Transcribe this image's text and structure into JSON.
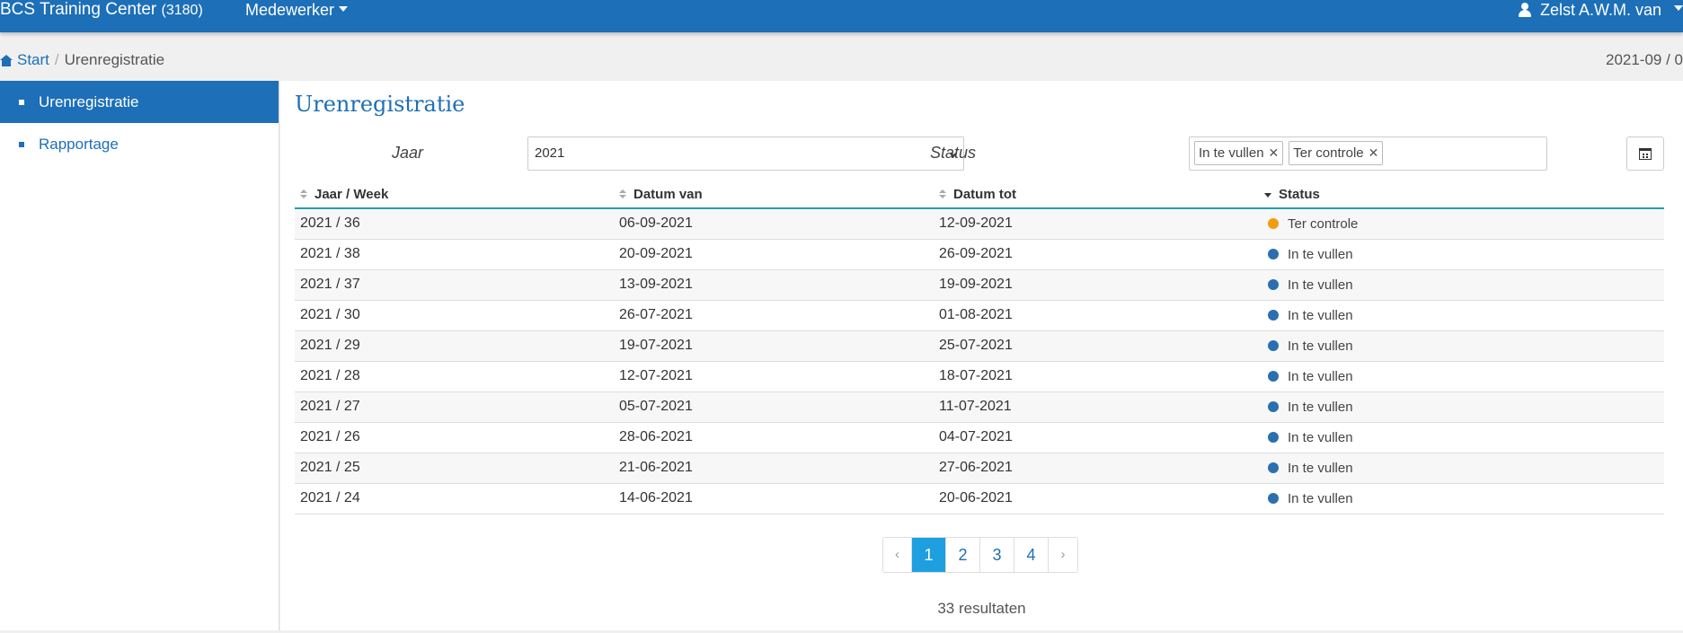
{
  "navbar": {
    "brand": "BCS Training Center",
    "brand_code": "(3180)",
    "menu_label": "Medewerker",
    "user_name": "Zelst A.W.M. van"
  },
  "breadcrumb": {
    "home": "Start",
    "current": "Urenregistratie",
    "date": "2021-09 / 0"
  },
  "sidebar": {
    "items": [
      {
        "label": "Urenregistratie"
      },
      {
        "label": "Rapportage"
      }
    ]
  },
  "main": {
    "title": "Urenregistratie",
    "filters": {
      "year_label": "Jaar",
      "year_value": "2021",
      "status_label": "Status",
      "status_tags": [
        "In te vullen",
        "Ter controle"
      ]
    },
    "table": {
      "headers": [
        "Jaar / Week",
        "Datum van",
        "Datum tot",
        "Status"
      ],
      "rows": [
        {
          "week": "2021 / 36",
          "from": "06-09-2021",
          "to": "12-09-2021",
          "status": "Ter controle",
          "color": "#f39c12"
        },
        {
          "week": "2021 / 38",
          "from": "20-09-2021",
          "to": "26-09-2021",
          "status": "In te vullen",
          "color": "#2c6fb0"
        },
        {
          "week": "2021 / 37",
          "from": "13-09-2021",
          "to": "19-09-2021",
          "status": "In te vullen",
          "color": "#2c6fb0"
        },
        {
          "week": "2021 / 30",
          "from": "26-07-2021",
          "to": "01-08-2021",
          "status": "In te vullen",
          "color": "#2c6fb0"
        },
        {
          "week": "2021 / 29",
          "from": "19-07-2021",
          "to": "25-07-2021",
          "status": "In te vullen",
          "color": "#2c6fb0"
        },
        {
          "week": "2021 / 28",
          "from": "12-07-2021",
          "to": "18-07-2021",
          "status": "In te vullen",
          "color": "#2c6fb0"
        },
        {
          "week": "2021 / 27",
          "from": "05-07-2021",
          "to": "11-07-2021",
          "status": "In te vullen",
          "color": "#2c6fb0"
        },
        {
          "week": "2021 / 26",
          "from": "28-06-2021",
          "to": "04-07-2021",
          "status": "In te vullen",
          "color": "#2c6fb0"
        },
        {
          "week": "2021 / 25",
          "from": "21-06-2021",
          "to": "27-06-2021",
          "status": "In te vullen",
          "color": "#2c6fb0"
        },
        {
          "week": "2021 / 24",
          "from": "14-06-2021",
          "to": "20-06-2021",
          "status": "In te vullen",
          "color": "#2c6fb0"
        }
      ]
    },
    "pagination": {
      "prev": "‹",
      "pages": [
        "1",
        "2",
        "3",
        "4"
      ],
      "next": "›"
    },
    "results": "33 resultaten"
  }
}
